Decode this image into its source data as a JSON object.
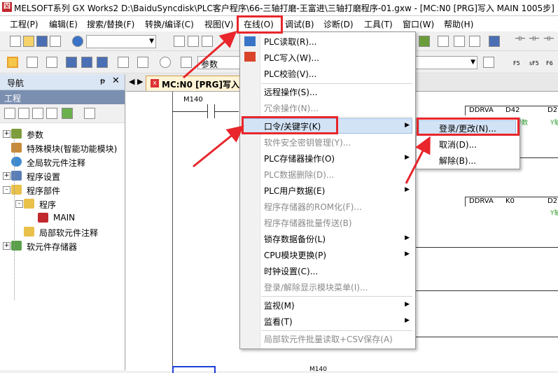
{
  "window": {
    "app_icon_text": "四",
    "title": "MELSOFT系列 GX Works2 D:\\BaiduSyncdisk\\PLC客户程序\\66-三轴打磨-王富进\\三轴打磨程序-01.gxw - [MC:N0 [PRG]写入 MAIN 1005步]"
  },
  "menubar": {
    "items": [
      "工程(P)",
      "编辑(E)",
      "搜索/替换(F)",
      "转换/编译(C)",
      "视图(V)",
      "在线(O)",
      "调试(B)",
      "诊断(D)",
      "工具(T)",
      "窗口(W)",
      "帮助(H)"
    ]
  },
  "toolbar": {
    "search_value": "参数",
    "labels": [
      "F5",
      "sF5",
      "F6"
    ]
  },
  "nav": {
    "header": "导航",
    "pin": "ᵽ",
    "close": "✕",
    "section": "工程",
    "tree": [
      {
        "label": "参数",
        "level": 0,
        "expander": "+"
      },
      {
        "label": "特殊模块(智能功能模块)",
        "level": 0,
        "expander": ""
      },
      {
        "label": "全局软元件注释",
        "level": 0,
        "expander": ""
      },
      {
        "label": "程序设置",
        "level": 0,
        "expander": "+"
      },
      {
        "label": "程序部件",
        "level": 0,
        "expander": "-"
      },
      {
        "label": "程序",
        "level": 1,
        "expander": "-"
      },
      {
        "label": "MAIN",
        "level": 2,
        "expander": ""
      },
      {
        "label": "局部软元件注释",
        "level": 1,
        "expander": ""
      },
      {
        "label": "软元件存储器",
        "level": 0,
        "expander": "+"
      }
    ]
  },
  "editor": {
    "tab_title": "MC:N0 [PRG]写入 I",
    "tab_close": "x",
    "contact1": "M140",
    "row1_instr": "DDRVA",
    "row1_arg1": "D42",
    "row1_arg2": "D2",
    "row1_note": "伴数",
    "row1_note2": "Y轴",
    "row2_instr": "DDRVA",
    "row2_arg1": "K0",
    "row2_arg2": "D2",
    "row2_note2": "Y轴",
    "bottom_label": "M140"
  },
  "online_menu": {
    "items": [
      {
        "label": "PLC读取(R)...",
        "enabled": true,
        "sub": false
      },
      {
        "label": "PLC写入(W)...",
        "enabled": true,
        "sub": false
      },
      {
        "label": "PLC校验(V)...",
        "enabled": true,
        "sub": false
      },
      {
        "label": "远程操作(S)...",
        "enabled": true,
        "sub": false
      },
      {
        "label": "冗余操作(N)...",
        "enabled": false,
        "sub": false
      },
      {
        "label": "口令/关键字(K)",
        "enabled": true,
        "sub": true
      },
      {
        "label": "软件安全密钥管理(Y)...",
        "enabled": false,
        "sub": false
      },
      {
        "label": "PLC存储器操作(O)",
        "enabled": true,
        "sub": true
      },
      {
        "label": "PLC数据删除(D)...",
        "enabled": false,
        "sub": false
      },
      {
        "label": "PLC用户数据(E)",
        "enabled": true,
        "sub": true
      },
      {
        "label": "程序存储器的ROM化(F)...",
        "enabled": false,
        "sub": false
      },
      {
        "label": "程序存储器批量传送(B)",
        "enabled": false,
        "sub": false
      },
      {
        "label": "锁存数据备份(L)",
        "enabled": true,
        "sub": true
      },
      {
        "label": "CPU模块更换(P)",
        "enabled": true,
        "sub": true
      },
      {
        "label": "时钟设置(C)...",
        "enabled": true,
        "sub": false
      },
      {
        "label": "登录/解除显示模块菜单(I)...",
        "enabled": false,
        "sub": false
      },
      {
        "label": "监视(M)",
        "enabled": true,
        "sub": true
      },
      {
        "label": "监看(T)",
        "enabled": true,
        "sub": true
      },
      {
        "label": "局部软元件批量读取+CSV保存(A)",
        "enabled": false,
        "sub": false
      }
    ],
    "submenu_arrow": "▶"
  },
  "password_submenu": {
    "items": [
      "登录/更改(N)...",
      "取消(D)...",
      "解除(B)..."
    ]
  },
  "colors": {
    "highlight_red": "#e8262b",
    "menu_hover": "#d3e3f6"
  }
}
